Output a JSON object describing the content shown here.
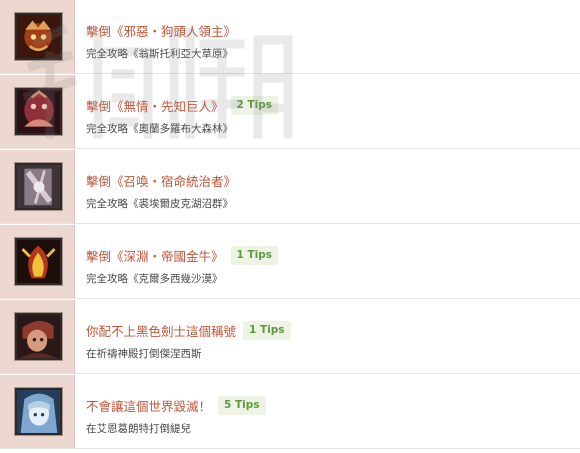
{
  "achievements": [
    {
      "title": "擊倒《邪惡・狗頭人領主》",
      "tips": "",
      "desc": "完全攻略《翁斯托利亞大草原》",
      "icon": "kobold-lord-portrait-icon",
      "palette": [
        "#3a160d",
        "#a23d19",
        "#e0a25a"
      ]
    },
    {
      "title": "擊倒《無情・先知巨人》",
      "tips": "2 Tips",
      "desc": "完全攻略《奧蘭多羅布大森林》",
      "icon": "giant-prophet-portrait-icon",
      "palette": [
        "#2b1016",
        "#8e2f3a",
        "#d98a77"
      ]
    },
    {
      "title": "擊倒《召喚・宿命統治者》",
      "tips": "",
      "desc": "完全攻略《裘埃爾皮克湖沼群》",
      "icon": "summon-ruler-portrait-icon",
      "palette": [
        "#3d3338",
        "#8a7a85",
        "#d5ccd4"
      ]
    },
    {
      "title": "擊倒《深淵・帝國金牛》",
      "tips": "1 Tips",
      "desc": "完全攻略《克爾多西幾沙漠》",
      "icon": "golden-bull-portrait-icon",
      "palette": [
        "#1c0e0a",
        "#b3361a",
        "#f2c13b"
      ]
    },
    {
      "title": "你配不上黑色劍士這個稱號",
      "tips": "1 Tips",
      "desc": "在祈禱神殿打倒傑涅西斯",
      "icon": "swordsman-portrait-icon",
      "palette": [
        "#2a1818",
        "#8c3a2c",
        "#d79a7c"
      ]
    },
    {
      "title": "不會讓這個世界毀滅！",
      "tips": "5 Tips",
      "desc": "在艾恩葛朗特打倒緹兒",
      "icon": "girl-portrait-icon",
      "palette": [
        "#253c5a",
        "#7fa6cf",
        "#e6eef7"
      ]
    }
  ]
}
